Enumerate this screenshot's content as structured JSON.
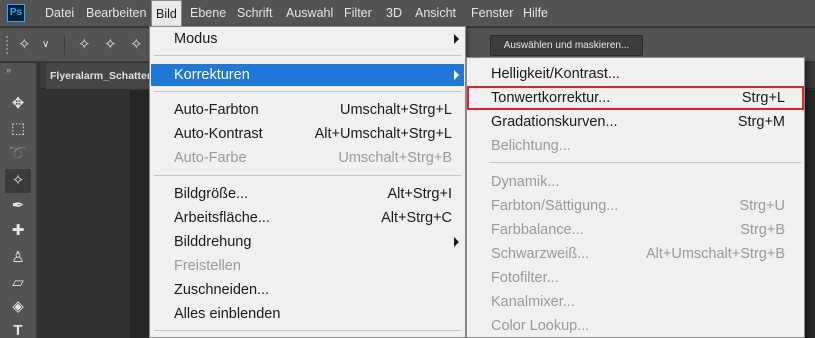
{
  "app": {
    "logo": "Ps"
  },
  "menubar": {
    "items": [
      "Datei",
      "Bearbeiten",
      "Bild",
      "Ebene",
      "Schrift",
      "Auswahl",
      "Filter",
      "3D",
      "Ansicht",
      "Fenster",
      "Hilfe"
    ],
    "active": "Bild"
  },
  "options": {
    "select_mask_label": "Auswählen und maskieren..."
  },
  "document": {
    "tab_title": "Flyeralarm_Schatten"
  },
  "toolbar": {
    "tools": [
      "move-tool",
      "marquee-tool",
      "lasso-tool",
      "quick-selection-tool",
      "eyedropper-tool",
      "healing-brush-tool",
      "clone-stamp-tool",
      "eraser-tool",
      "paint-bucket-tool",
      "type-tool"
    ]
  },
  "bild_menu": {
    "items": [
      {
        "label": "Modus",
        "shortcut": "",
        "submenu": true,
        "disabled": false
      },
      {
        "label": "Korrekturen",
        "shortcut": "",
        "submenu": true,
        "disabled": false,
        "highlighted": true
      },
      {
        "label": "Auto-Farbton",
        "shortcut": "Umschalt+Strg+L",
        "disabled": false
      },
      {
        "label": "Auto-Kontrast",
        "shortcut": "Alt+Umschalt+Strg+L",
        "disabled": false
      },
      {
        "label": "Auto-Farbe",
        "shortcut": "Umschalt+Strg+B",
        "disabled": true
      },
      {
        "label": "Bildgröße...",
        "shortcut": "Alt+Strg+I",
        "disabled": false
      },
      {
        "label": "Arbeitsfläche...",
        "shortcut": "Alt+Strg+C",
        "disabled": false
      },
      {
        "label": "Bilddrehung",
        "shortcut": "",
        "submenu": true,
        "disabled": false
      },
      {
        "label": "Freistellen",
        "shortcut": "",
        "disabled": true
      },
      {
        "label": "Zuschneiden...",
        "shortcut": "",
        "disabled": false
      },
      {
        "label": "Alles einblenden",
        "shortcut": "",
        "disabled": false
      }
    ]
  },
  "korrekturen_menu": {
    "items": [
      {
        "label": "Helligkeit/Kontrast...",
        "shortcut": "",
        "disabled": false
      },
      {
        "label": "Tonwertkorrektur...",
        "shortcut": "Strg+L",
        "disabled": false,
        "boxed": true
      },
      {
        "label": "Gradationskurven...",
        "shortcut": "Strg+M",
        "disabled": false
      },
      {
        "label": "Belichtung...",
        "shortcut": "",
        "disabled": true
      },
      {
        "label": "Dynamik...",
        "shortcut": "",
        "disabled": true
      },
      {
        "label": "Farbton/Sättigung...",
        "shortcut": "Strg+U",
        "disabled": true
      },
      {
        "label": "Farbbalance...",
        "shortcut": "Strg+B",
        "disabled": true
      },
      {
        "label": "Schwarzweiß...",
        "shortcut": "Alt+Umschalt+Strg+B",
        "disabled": true
      },
      {
        "label": "Fotofilter...",
        "shortcut": "",
        "disabled": true
      },
      {
        "label": "Kanalmixer...",
        "shortcut": "",
        "disabled": true
      },
      {
        "label": "Color Lookup...",
        "shortcut": "",
        "disabled": true
      }
    ]
  },
  "colors": {
    "highlight": "#1e78d7",
    "annotation_box": "#d9242b",
    "chrome": "#535353",
    "menu_bg": "#f0f0f0"
  }
}
